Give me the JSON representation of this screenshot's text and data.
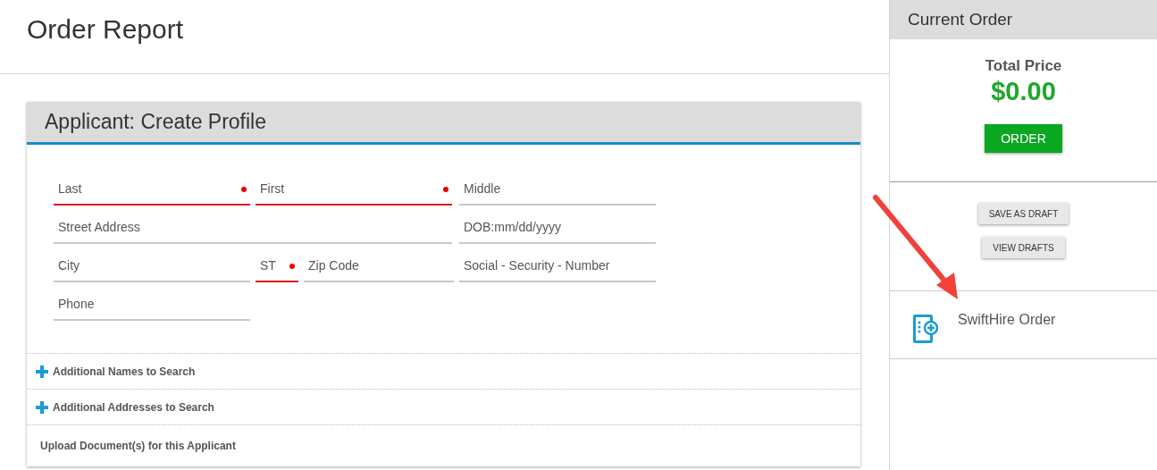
{
  "page": {
    "title": "Order Report"
  },
  "profile": {
    "title": "Applicant: Create Profile",
    "fields": [
      {
        "placeholder": "Last",
        "required": true
      },
      {
        "placeholder": "First",
        "required": true
      },
      {
        "placeholder": "Middle",
        "required": false
      },
      {
        "placeholder": "Street Address",
        "required": false
      },
      {
        "placeholder": "DOB:mm/dd/yyyy",
        "required": false
      },
      {
        "placeholder": "City",
        "required": false
      },
      {
        "placeholder": "ST",
        "required": true
      },
      {
        "placeholder": "Zip Code",
        "required": false
      },
      {
        "placeholder": "Social - Security - Number",
        "required": false
      },
      {
        "placeholder": "Phone",
        "required": false
      }
    ],
    "sections": [
      {
        "label": "Additional Names to Search",
        "expandable": true
      },
      {
        "label": "Additional Addresses to Search",
        "expandable": true
      },
      {
        "label": "Upload Document(s) for this Applicant",
        "expandable": false
      }
    ]
  },
  "current_order": {
    "title": "Current Order",
    "total_label": "Total Price",
    "total": "$0.00",
    "order_button": "ORDER",
    "draft_buttons": [
      "SAVE AS DRAFT",
      "VIEW DRAFTS"
    ],
    "swifthire_label": "SwiftHire Order"
  }
}
